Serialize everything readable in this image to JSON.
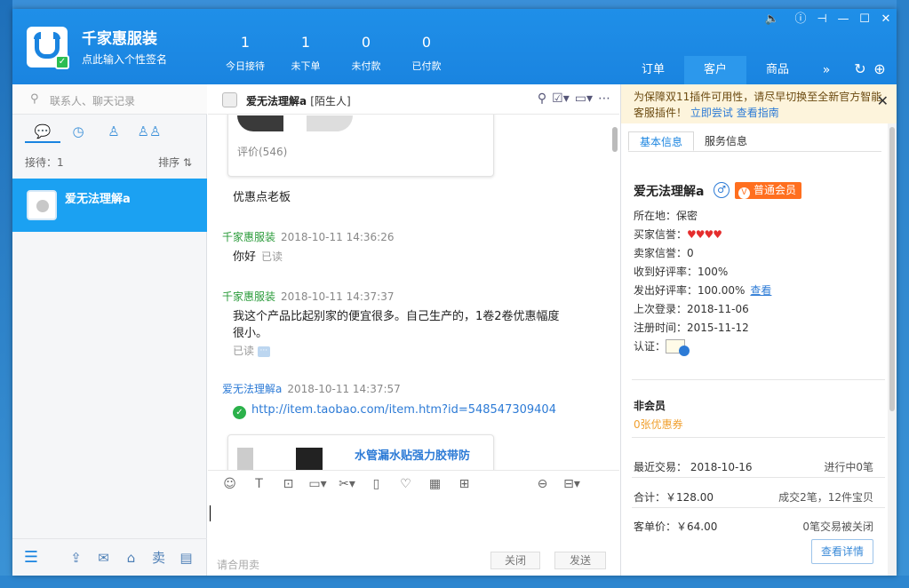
{
  "header": {
    "shop_name": "千家惠服装",
    "signature": "点此输入个性签名",
    "stats": [
      {
        "num": "1",
        "label": "今日接待"
      },
      {
        "num": "1",
        "label": "未下单"
      },
      {
        "num": "0",
        "label": "未付款"
      },
      {
        "num": "0",
        "label": "已付款"
      }
    ],
    "tabs": [
      "订单",
      "客户",
      "商品"
    ],
    "more": "»"
  },
  "left": {
    "search_placeholder": "联系人、聊天记录",
    "reception": "接待：1",
    "sort": "排序 ⇅",
    "contact_name": "爱无法理解a"
  },
  "chat": {
    "header_name": "爱无法理解a",
    "header_tag": "[陌生人]",
    "card_rating": "评价(546)",
    "msg1": "优惠点老板",
    "meta1_sender": "千家惠服装",
    "meta1_time": "2018-10-11 14:36:26",
    "msg2": "你好",
    "read": "已读",
    "meta2_sender": "千家惠服装",
    "meta2_time": "2018-10-11 14:37:37",
    "msg3": "我这个产品比起别家的便宜很多。自己生产的，1卷2卷优惠幅度很小。",
    "read2": "已读",
    "meta3_sender": "爱无法理解a",
    "meta3_time": "2018-10-11 14:37:57",
    "link": "http://item.taobao.com/item.htm?id=548547309404",
    "card2_title": "水管漏水贴强力胶带防",
    "quick_reply": "请合用卖",
    "close_btn": "关闭",
    "send_btn": "发送"
  },
  "right": {
    "notice_text": "为保障双11插件可用性，请尽早切换至全新官方智能客服插件！",
    "notice_link1": "立即尝试",
    "notice_link2": "查看指南",
    "tab_basic": "基本信息",
    "tab_service": "服务信息",
    "buyer_name": "爱无法理解a",
    "vip": "普通会员",
    "location": "所在地：保密",
    "buyer_credit": "买家信誉：",
    "seller_credit": "卖家信誉：0",
    "received_good": "收到好评率：100%",
    "sent_good": "发出好评率：100.00%",
    "view": "查看",
    "last_login": "上次登录：2018-11-06",
    "register": "注册时间：2015-11-12",
    "cert": "认证：",
    "nonmember": "非会员",
    "coupon": "0张优惠券",
    "recent_trade": "最近交易： 2018-10-16",
    "in_progress": "进行中0笔",
    "total": "合计：￥128.00",
    "deals": "成交2笔，12件宝贝",
    "avg": "客单价：￥64.00",
    "closed": "0笔交易被关闭",
    "detail_btn": "查看详情"
  }
}
